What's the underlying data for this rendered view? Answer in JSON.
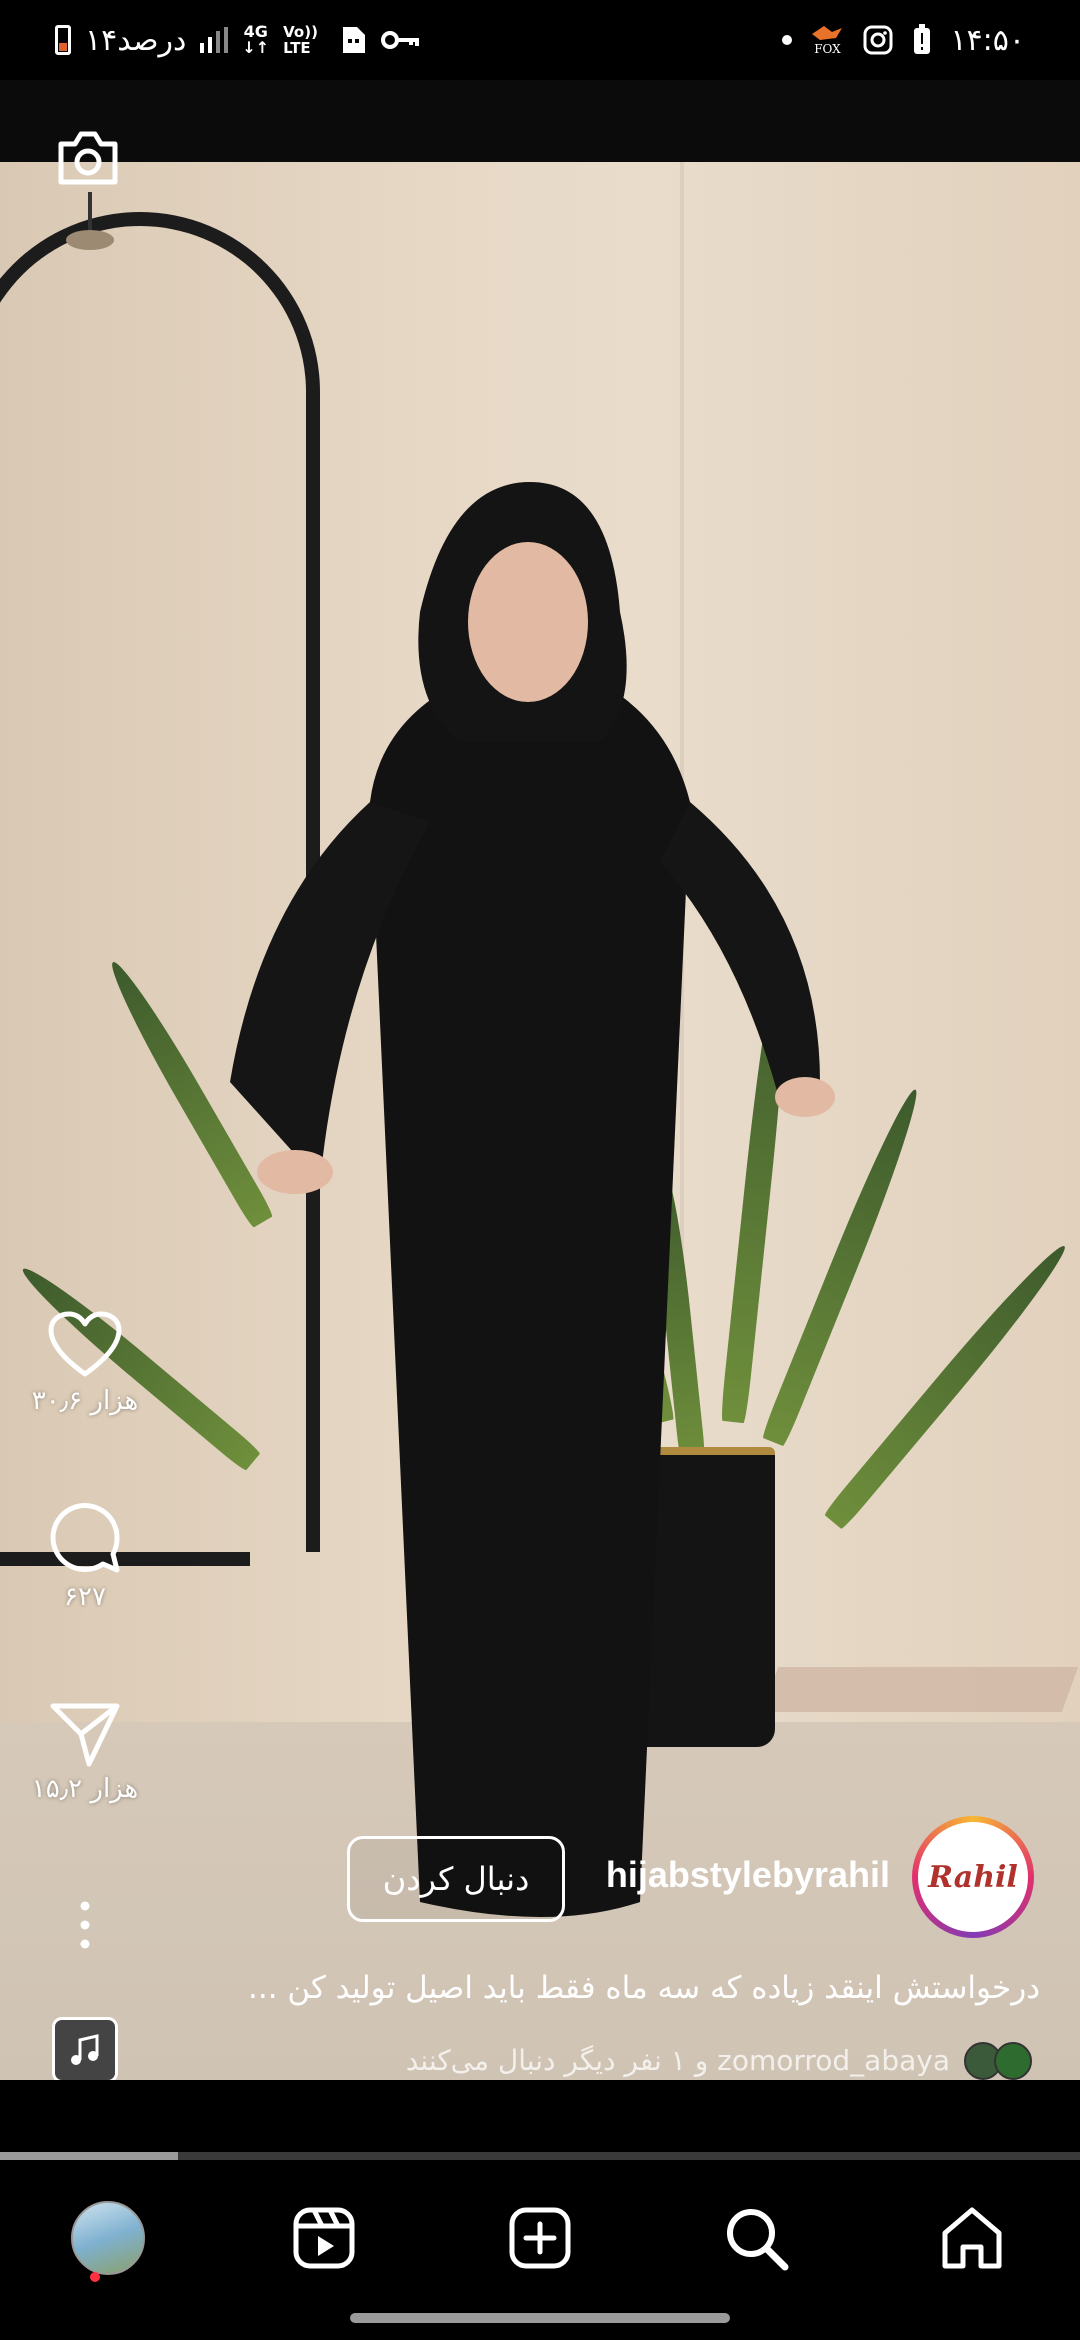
{
  "status_bar": {
    "battery_percent_text": "۱۴درصد",
    "network_4g": "4G",
    "network_volte": "Vo)) LTE",
    "time": "۱۴:۵۰",
    "fox_label": "FOX"
  },
  "reel": {
    "likes_count": "۳۰٫۶ هزار",
    "comments_count": "۶۲۷",
    "shares_count": "۱۵٫۲ هزار",
    "author_username": "hijabstylebyrahil",
    "author_avatar_text": "Rahil",
    "follow_label": "دنبال کردن",
    "caption": "درخواستش اینقد زیاده که سه ماه فقط باید اصیل تولید کن ...",
    "followed_by_text": "zomorrod_abaya و ۱ نفر دیگر دنبال می‌کنند",
    "progress": 0.165
  },
  "icons": {
    "camera": "camera-icon",
    "like": "heart-icon",
    "comment": "comment-icon",
    "share": "send-icon",
    "more": "more-vertical-icon",
    "audio": "music-icon"
  },
  "bottom_nav": {
    "items": [
      "profile",
      "reels",
      "create",
      "search",
      "home"
    ]
  },
  "colors": {
    "background": "#000000",
    "text": "#ffffff",
    "notification_dot": "#ff3040"
  }
}
